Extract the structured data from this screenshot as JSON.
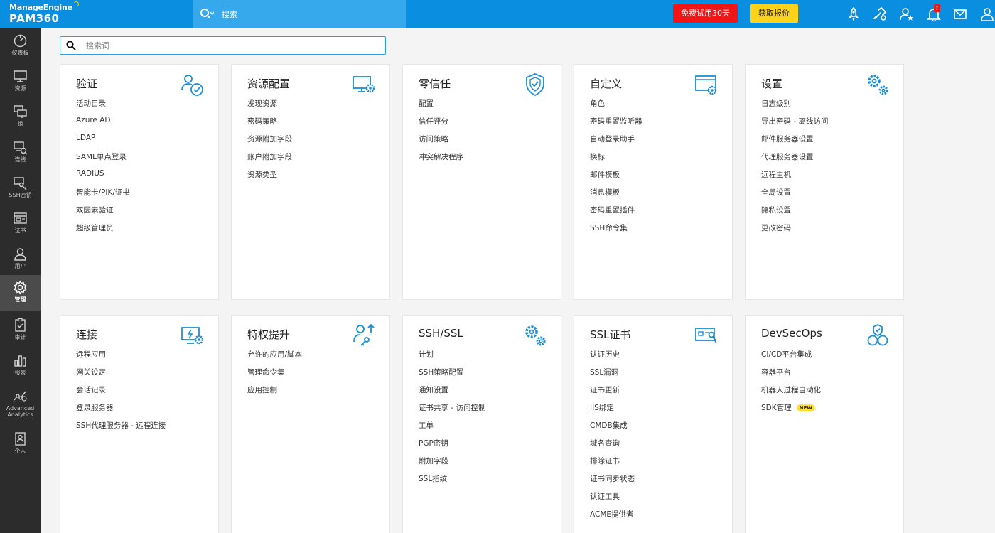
{
  "brand": {
    "vendor": "ManageEngine",
    "product": "PAM360"
  },
  "topbar": {
    "search_label": "搜索",
    "trial_button": "免费试用30天",
    "quote_button": "获取报价",
    "notification_count": "!",
    "icons": [
      "rocket-icon",
      "link-gear-icon",
      "user-star-icon",
      "bell-icon",
      "mail-icon",
      "user-icon"
    ],
    "colors": {
      "bar": "#0a8ee0",
      "search": "#36a9ec",
      "trial": "#f21515",
      "quote": "#ffd31a"
    }
  },
  "sidebar": {
    "items": [
      {
        "label": "仪表板",
        "icon": "dashboard-icon"
      },
      {
        "label": "资源",
        "icon": "monitor-icon"
      },
      {
        "label": "组",
        "icon": "group-monitors-icon"
      },
      {
        "label": "连接",
        "icon": "connection-icon"
      },
      {
        "label": "SSH密钥",
        "icon": "ssh-key-icon"
      },
      {
        "label": "证书",
        "icon": "certificate-icon"
      },
      {
        "label": "用户",
        "icon": "user-icon"
      },
      {
        "label": "管理",
        "icon": "gear-icon",
        "active": true
      },
      {
        "label": "审计",
        "icon": "clipboard-icon"
      },
      {
        "label": "报表",
        "icon": "bar-chart-icon"
      },
      {
        "label": "Advanced Analytics",
        "icon": "analytics-icon"
      },
      {
        "label": "个人",
        "icon": "id-card-icon"
      }
    ]
  },
  "main": {
    "search_placeholder": "搜索词",
    "accent_color": "#1a8fd6",
    "cards": [
      {
        "title": "验证",
        "icon": "user-check-icon",
        "items": [
          "活动目录",
          "Azure AD",
          "LDAP",
          "SAML单点登录",
          "RADIUS",
          "智能卡/PIK/证书",
          "双因素验证",
          "超级管理员"
        ]
      },
      {
        "title": "资源配置",
        "icon": "monitor-gear-icon",
        "items": [
          "发现资源",
          "密码策略",
          "资源附加字段",
          "账户附加字段",
          "资源类型"
        ]
      },
      {
        "title": "零信任",
        "icon": "shield-check-icon",
        "items": [
          "配置",
          "信任评分",
          "访问策略",
          "冲突解决程序"
        ]
      },
      {
        "title": "自定义",
        "icon": "window-gear-icon",
        "items": [
          "角色",
          "密码重置监听器",
          "自动登录助手",
          "换标",
          "邮件模板",
          "消息模板",
          "密码重置插件",
          "SSH命令集"
        ]
      },
      {
        "title": "设置",
        "icon": "gears-icon",
        "items": [
          "日志级别",
          "导出密码 - 离线访问",
          "邮件服务器设置",
          "代理服务器设置",
          "远程主机",
          "全局设置",
          "隐私设置",
          "更改密码"
        ]
      },
      {
        "title": "连接",
        "icon": "remote-connection-icon",
        "items": [
          "远程应用",
          "网关设定",
          "会话记录",
          "登录服务器",
          "SSH代理服务器 - 远程连接"
        ]
      },
      {
        "title": "特权提升",
        "icon": "user-elevate-icon",
        "items": [
          "允许的应用/脚本",
          "管理命令集",
          "应用控制"
        ]
      },
      {
        "title": "SSH/SSL",
        "icon": "gears-icon",
        "items": [
          "计划",
          "SSH策略配置",
          "通知设置",
          "证书共享 - 访问控制",
          "工单",
          "PGP密钥",
          "附加字段",
          "SSL指纹"
        ]
      },
      {
        "title": "SSL证书",
        "icon": "certificate-key-icon",
        "items": [
          "认证历史",
          "SSL漏洞",
          "证书更新",
          "IIS绑定",
          "CMDB集成",
          "域名查询",
          "排除证书",
          "证书同步状态",
          "认证工具",
          "ACME提供者"
        ]
      },
      {
        "title": "DevSecOps",
        "icon": "devsecops-icon",
        "items": [
          "CI/CD平台集成",
          "容器平台",
          "机器人过程自动化",
          "SDK管理"
        ],
        "new_badge": "NEW"
      }
    ]
  }
}
